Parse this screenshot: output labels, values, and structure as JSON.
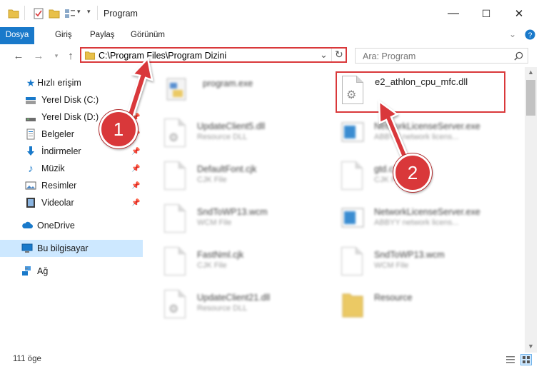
{
  "window": {
    "title": "Program",
    "minimize": "—",
    "maximize": "☐",
    "close": "✕"
  },
  "ribbon": {
    "tabs": [
      "Dosya",
      "Giriş",
      "Paylaş",
      "Görünüm"
    ],
    "accent": "#1979ca"
  },
  "address": {
    "path": "C:\\Program Files\\Program Dizini",
    "refresh": "↻",
    "dropdown": "⌄"
  },
  "search": {
    "placeholder": "Ara: Program"
  },
  "nav": {
    "items": [
      {
        "label": "Hızlı erişim",
        "icon": "star-icon",
        "pinned": false
      },
      {
        "label": "Yerel Disk (C:)",
        "icon": "drive-icon",
        "pinned": true
      },
      {
        "label": "Yerel Disk (D:)",
        "icon": "drive-icon",
        "pinned": true
      },
      {
        "label": "Belgeler",
        "icon": "documents-icon",
        "pinned": true
      },
      {
        "label": "İndirmeler",
        "icon": "download-icon",
        "pinned": true
      },
      {
        "label": "Müzik",
        "icon": "music-icon",
        "pinned": true
      },
      {
        "label": "Resimler",
        "icon": "pictures-icon",
        "pinned": true
      },
      {
        "label": "Videolar",
        "icon": "video-icon",
        "pinned": true
      },
      {
        "label": "OneDrive",
        "icon": "cloud-icon",
        "pinned": false
      },
      {
        "label": "Bu bilgisayar",
        "icon": "computer-icon",
        "pinned": false
      },
      {
        "label": "Ağ",
        "icon": "network-icon",
        "pinned": false
      }
    ]
  },
  "files": [
    {
      "name": "program.exe",
      "type": "",
      "icon": "exe-icon"
    },
    {
      "name": "e2_athlon_cpu_mfc.dll",
      "type": "",
      "icon": "dll-icon"
    },
    {
      "name": "UpdateClient5.dll",
      "type": "Resource DLL",
      "icon": "dll-icon"
    },
    {
      "name": "NetworkLicenseServer.exe",
      "type": "ABBYY network licens...",
      "icon": "exe-icon"
    },
    {
      "name": "DefaultFont.cjk",
      "type": "CJK File",
      "icon": "doc-icon"
    },
    {
      "name": "gtd.cjk",
      "type": "CJK File",
      "icon": "doc-icon"
    },
    {
      "name": "SndToWP13.wcm",
      "type": "WCM File",
      "icon": "doc-icon"
    },
    {
      "name": "NetworkLicenseServer.exe",
      "type": "ABBYY network licens...",
      "icon": "exe-icon"
    },
    {
      "name": "FastNml.cjk",
      "type": "CJK File",
      "icon": "doc-icon"
    },
    {
      "name": "SndToWP13.wcm",
      "type": "WCM File",
      "icon": "doc-icon"
    },
    {
      "name": "UpdateClient21.dll",
      "type": "Resource DLL",
      "icon": "dll-icon"
    },
    {
      "name": "Resource",
      "type": "",
      "icon": "folder-icon"
    }
  ],
  "status": {
    "count": "111 öge"
  },
  "annotations": {
    "step1": "1",
    "step2": "2",
    "color": "#d9383a"
  }
}
